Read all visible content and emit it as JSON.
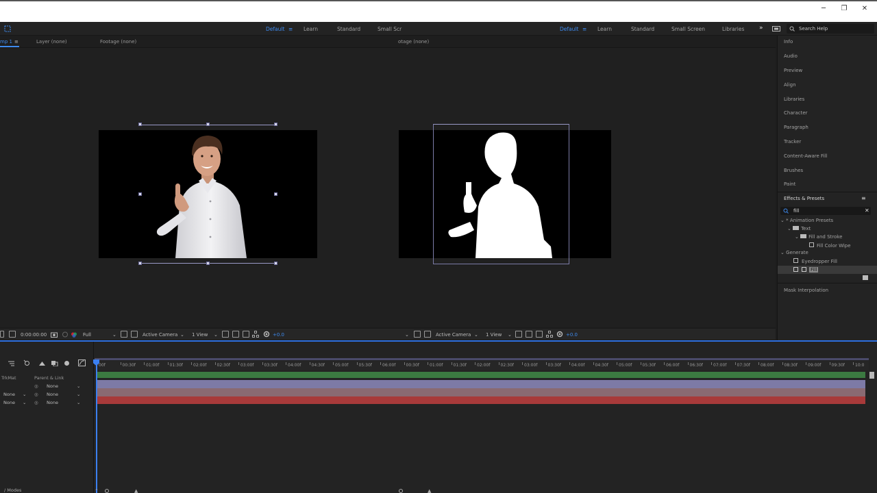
{
  "window": {
    "minimize": "─",
    "restore": "❐",
    "close": "✕"
  },
  "workspaces_left": [
    {
      "label": "Default",
      "active": true
    },
    {
      "label": "Learn",
      "active": false
    },
    {
      "label": "Standard",
      "active": false
    },
    {
      "label": "Small Scr",
      "active": false
    }
  ],
  "workspaces_right": [
    {
      "label": "Default",
      "active": true
    },
    {
      "label": "Learn",
      "active": false
    },
    {
      "label": "Standard",
      "active": false
    },
    {
      "label": "Small Screen",
      "active": false
    },
    {
      "label": "Libraries",
      "active": false
    }
  ],
  "more_label": "»",
  "search": {
    "placeholder": "Search Help"
  },
  "tabs": {
    "comp": "mp 1",
    "layer": "Layer (none)",
    "footage": "Footage (none)",
    "footage_right": "otage (none)"
  },
  "viewer_toolbar_left": {
    "timecode": "0:00:00:00",
    "resolution": "Full",
    "camera": "Active Camera",
    "view": "1 View",
    "exposure": "+0.0"
  },
  "viewer_toolbar_right": {
    "camera": "Active Camera",
    "view": "1 View",
    "exposure": "+0.0"
  },
  "right_panel": {
    "items": [
      "Info",
      "Audio",
      "Preview",
      "Align",
      "Libraries",
      "Character",
      "Paragraph",
      "Tracker",
      "Content-Aware Fill",
      "Brushes",
      "Paint"
    ],
    "effects_title": "Effects & Presets",
    "effects_search": "fill",
    "tree": {
      "animation_presets": "* Animation Presets",
      "text": "Text",
      "fill_and_stroke": "Fill and Stroke",
      "fill_color_wipe": "Fill Color Wipe",
      "generate": "Generate",
      "eyedropper_fill": "Eyedropper Fill",
      "fill": "Fill"
    },
    "mask_interpolation": "Mask Interpolation"
  },
  "timeline": {
    "header": {
      "trkmat": "TrkMat",
      "parent": "Parent & Link"
    },
    "rows": [
      {
        "trkmat": "",
        "parent": "None"
      },
      {
        "trkmat": "None",
        "parent": "None"
      },
      {
        "trkmat": "None",
        "parent": "None"
      }
    ],
    "ticks": [
      "00f",
      "00:30f",
      "01:00f",
      "01:30f",
      "02:00f",
      "02:30f",
      "03:00f",
      "03:30f",
      "04:00f",
      "04:30f",
      "05:00f",
      "05:30f",
      "06:00f",
      "00:30f",
      "01:00f",
      "01:30f",
      "02:00f",
      "02:30f",
      "03:00f",
      "03:30f",
      "04:00f",
      "04:30f",
      "05:00f",
      "05:30f",
      "06:00f",
      "06:30f",
      "07:00f",
      "07:30f",
      "08:00f",
      "08:30f",
      "09:00f",
      "09:30f",
      "10:0"
    ],
    "footer": "/ Modes"
  },
  "colors": {
    "accent": "#3e8bf0",
    "layer1": "#7d7aa6",
    "layer2": "#8a6a72",
    "layer3": "#a83a3a",
    "track_green": "#3f8a46"
  }
}
